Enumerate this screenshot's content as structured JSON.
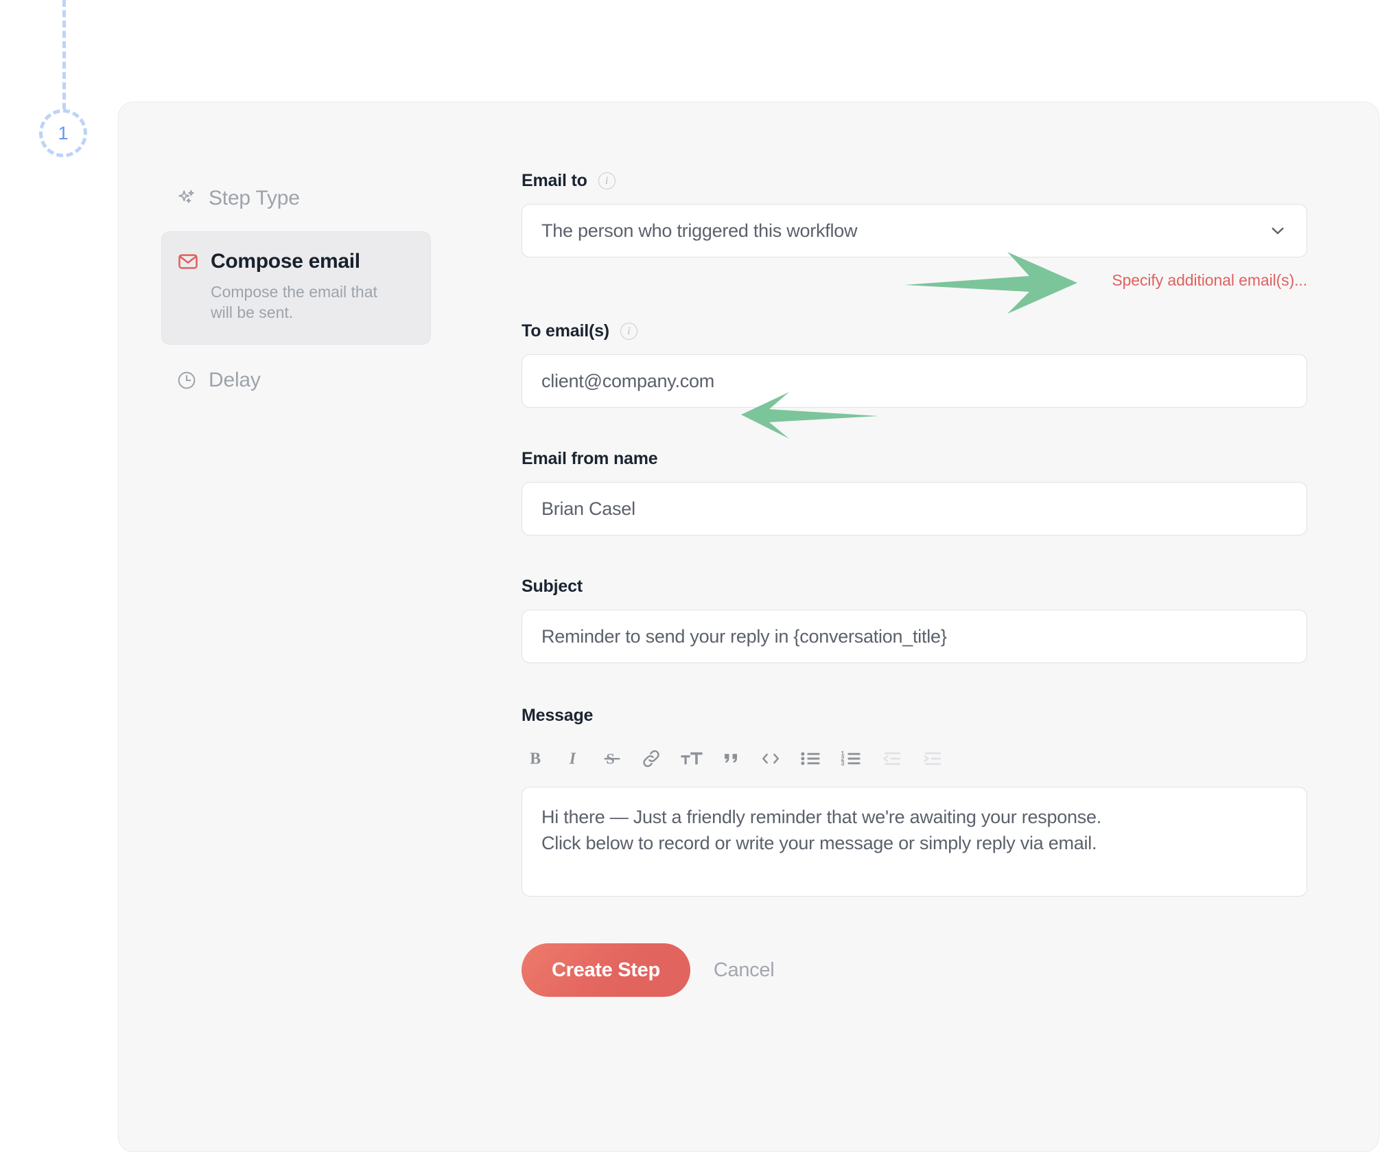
{
  "step_indicator": {
    "number": "1"
  },
  "sidebar": {
    "items": [
      {
        "label": "Step Type",
        "icon": "sparkles-icon",
        "selected": false
      },
      {
        "label": "Compose email",
        "description": "Compose the email that will be sent.",
        "icon": "envelope-icon",
        "selected": true
      },
      {
        "label": "Delay",
        "icon": "clock-icon",
        "selected": false
      }
    ]
  },
  "form": {
    "email_to": {
      "label": "Email to",
      "value": "The person who triggered this workflow",
      "info_icon": "info-icon",
      "chevron_icon": "chevron-down-icon"
    },
    "specify_additional_link": "Specify additional email(s)...",
    "to_emails": {
      "label": "To email(s)",
      "value": "client@company.com",
      "info_icon": "info-icon"
    },
    "email_from_name": {
      "label": "Email from name",
      "value": "Brian Casel"
    },
    "subject": {
      "label": "Subject",
      "value": "Reminder to send your reply in {conversation_title}"
    },
    "message": {
      "label": "Message",
      "line1": "Hi there — Just a friendly reminder that we're awaiting your response.",
      "line2": "Click below to record or write your message or simply reply via email.",
      "toolbar": [
        {
          "name": "bold-icon",
          "label": "B"
        },
        {
          "name": "italic-icon",
          "label": "I"
        },
        {
          "name": "strikethrough-icon",
          "label": "S"
        },
        {
          "name": "link-icon",
          "label": "Link"
        },
        {
          "name": "text-size-icon",
          "label": "TT"
        },
        {
          "name": "blockquote-icon",
          "label": "Quote"
        },
        {
          "name": "code-icon",
          "label": "<>"
        },
        {
          "name": "bulleted-list-icon",
          "label": "Bulleted list"
        },
        {
          "name": "numbered-list-icon",
          "label": "Numbered list"
        },
        {
          "name": "outdent-icon",
          "label": "Outdent",
          "disabled": true
        },
        {
          "name": "indent-icon",
          "label": "Indent",
          "disabled": true
        }
      ]
    }
  },
  "actions": {
    "create_step": "Create Step",
    "cancel": "Cancel"
  },
  "colors": {
    "accent_red": "#e0635d",
    "link_red": "#e1605c",
    "step_blue": "#6694ee",
    "annotation_green": "#7cc49a",
    "card_bg": "#f7f7f8"
  }
}
